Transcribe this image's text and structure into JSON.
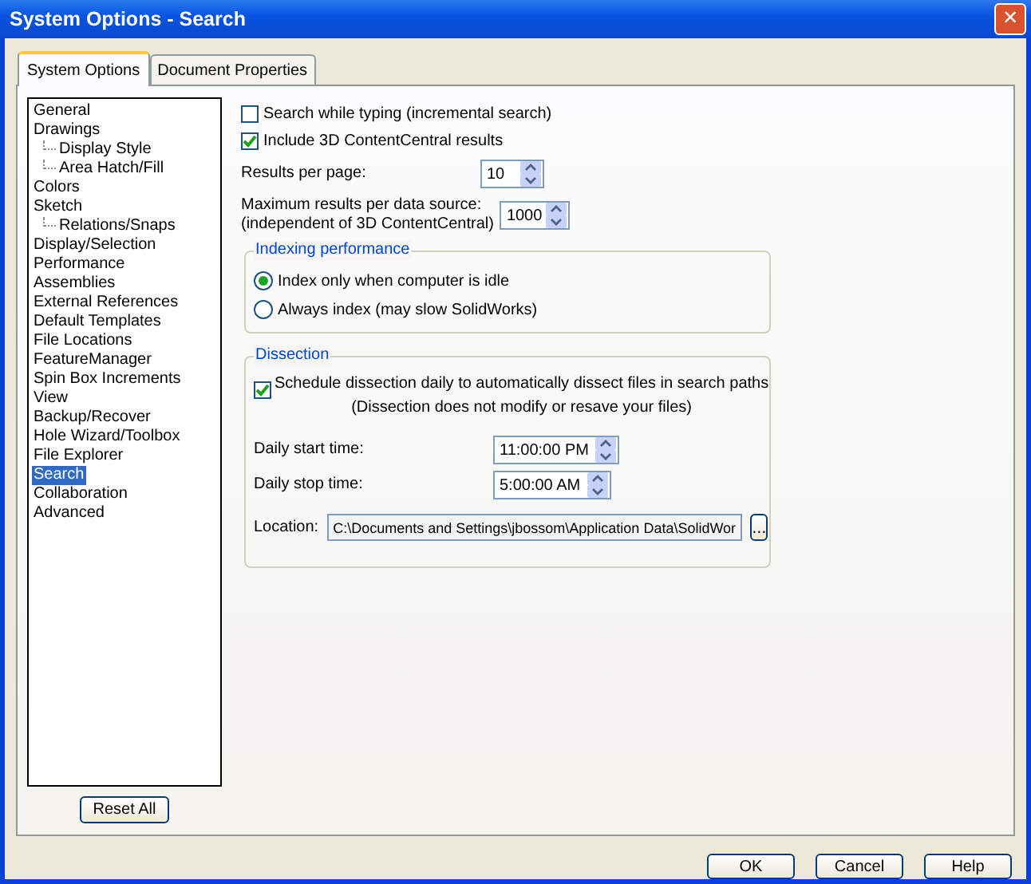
{
  "window": {
    "title": "System Options - Search",
    "close": "×"
  },
  "tabs": [
    {
      "label": "System Options",
      "selected": true
    },
    {
      "label": "Document Properties",
      "selected": false
    }
  ],
  "tree": [
    {
      "label": "General",
      "selected": false
    },
    {
      "label": "Drawings",
      "selected": false,
      "children": [
        {
          "label": "Display Style",
          "selected": false
        },
        {
          "label": "Area Hatch/Fill",
          "selected": false
        }
      ]
    },
    {
      "label": "Colors",
      "selected": false
    },
    {
      "label": "Sketch",
      "selected": false,
      "children": [
        {
          "label": "Relations/Snaps",
          "selected": false
        }
      ]
    },
    {
      "label": "Display/Selection",
      "selected": false
    },
    {
      "label": "Performance",
      "selected": false
    },
    {
      "label": "Assemblies",
      "selected": false
    },
    {
      "label": "External References",
      "selected": false
    },
    {
      "label": "Default Templates",
      "selected": false
    },
    {
      "label": "File Locations",
      "selected": false
    },
    {
      "label": "FeatureManager",
      "selected": false
    },
    {
      "label": "Spin Box Increments",
      "selected": false
    },
    {
      "label": "View",
      "selected": false
    },
    {
      "label": "Backup/Recover",
      "selected": false
    },
    {
      "label": "Hole Wizard/Toolbox",
      "selected": false
    },
    {
      "label": "File Explorer",
      "selected": false
    },
    {
      "label": "Search",
      "selected": true
    },
    {
      "label": "Collaboration",
      "selected": false
    },
    {
      "label": "Advanced",
      "selected": false
    }
  ],
  "reset_button": "Reset All",
  "options": [
    {
      "label": "Search while typing (incremental search)",
      "checked": false
    },
    {
      "label": "Include 3D ContentCentral results",
      "checked": true
    }
  ],
  "spinners": [
    {
      "label": "Results per page:",
      "value": "10"
    },
    {
      "label": "Maximum results per data source:\n(independent of 3D ContentCentral)",
      "value": "1000"
    }
  ],
  "indexing": {
    "title": "Indexing performance",
    "radios": [
      {
        "label": "Index only when computer is idle",
        "selected": true
      },
      {
        "label": "Always index (may slow SolidWorks)",
        "selected": false
      }
    ]
  },
  "dissection": {
    "title": "Dissection",
    "schedule": {
      "label": "Schedule dissection daily to automatically dissect files in search paths",
      "note": "(Dissection does not modify or resave your files)",
      "checked": true
    },
    "times": [
      {
        "label": "Daily start time:",
        "value": "11:00:00 PM"
      },
      {
        "label": "Daily stop time:",
        "value": "5:00:00 AM"
      }
    ],
    "location": {
      "label": "Location:",
      "value": "C:\\Documents and Settings\\jbossom\\Application Data\\SolidWor",
      "browse": "..."
    }
  },
  "buttons": [
    "OK",
    "Cancel",
    "Help"
  ]
}
